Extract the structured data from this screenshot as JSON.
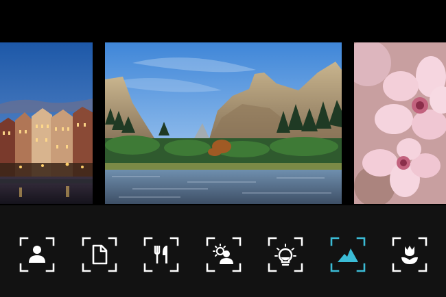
{
  "photos": [
    {
      "subject": "harbor-town-at-dusk",
      "position": "left-partial"
    },
    {
      "subject": "mountain-valley-with-river",
      "position": "center"
    },
    {
      "subject": "pink-blossom-closeup",
      "position": "right-partial"
    }
  ],
  "modes": [
    {
      "icon": "portrait-icon",
      "active": false
    },
    {
      "icon": "document-icon",
      "active": false
    },
    {
      "icon": "food-icon",
      "active": false
    },
    {
      "icon": "backlit-portrait-icon",
      "active": false
    },
    {
      "icon": "night-bulb-icon",
      "active": false
    },
    {
      "icon": "landscape-icon",
      "active": true
    },
    {
      "icon": "flower-icon",
      "active": false
    }
  ],
  "colors": {
    "background": "#000000",
    "mode_bar": "#121212",
    "icon_default": "#ffffff",
    "icon_active": "#3bbcd6"
  }
}
